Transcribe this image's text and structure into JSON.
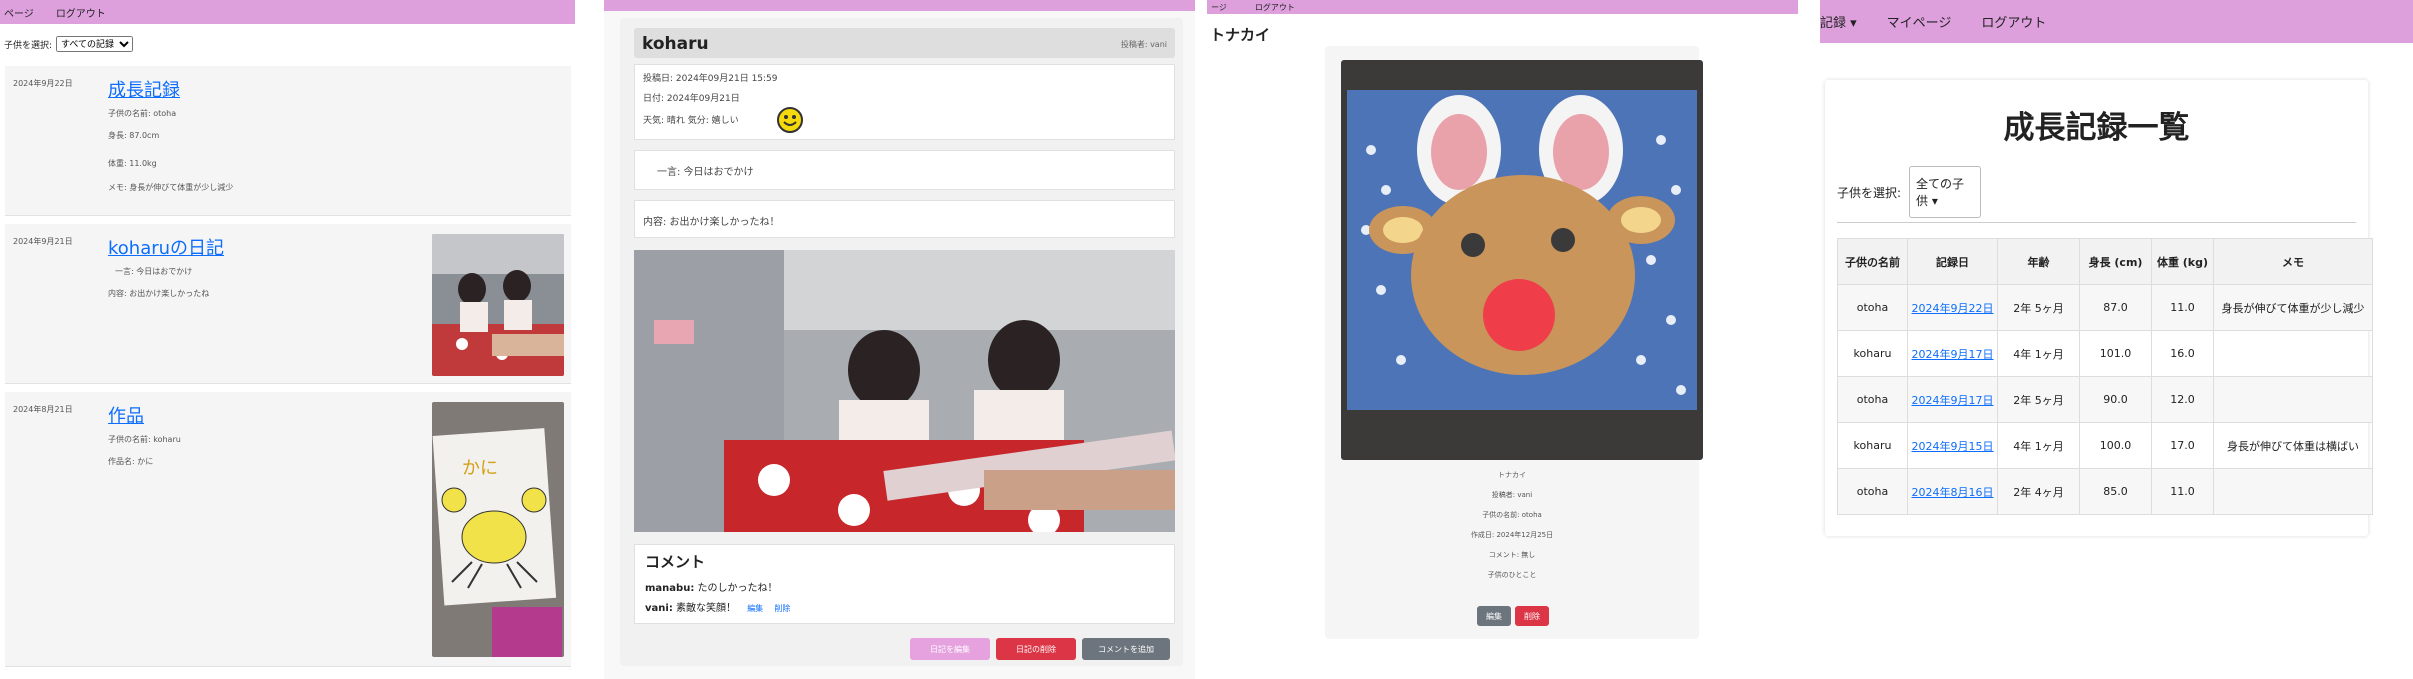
{
  "panel1": {
    "nav": [
      "ページ",
      "ログアウト"
    ],
    "filter_label": "子供を選択:",
    "filter_value": "すべての記録",
    "entries": [
      {
        "date": "2024年9月22日",
        "title": "成長記録",
        "lines": [
          "子供の名前: otoha",
          "身長: 87.0cm",
          "体重: 11.0kg",
          "メモ: 身長が伸びて体重が少し減少"
        ]
      },
      {
        "date": "2024年9月21日",
        "title": "koharuの日記",
        "lines": [
          "一言: 今日はおでかけ",
          "内容: お出かけ楽しかったね"
        ]
      },
      {
        "date": "2024年8月21日",
        "title": "作品",
        "lines": [
          "子供の名前: koharu",
          "作品名: かに"
        ]
      }
    ]
  },
  "panel2": {
    "child_name": "koharu",
    "poster": "投稿者: vani",
    "posted": "投稿日: 2024年09月21日 15:59",
    "date": "日付: 2024年09月21日",
    "weather": "天気: 晴れ  気分: 嬉しい",
    "oneline": "一言: 今日はおでかけ",
    "content": "内容: お出かけ楽しかったね！",
    "comment_title": "コメント",
    "comments": [
      {
        "user": "manabu:",
        "text": "たのしかったね！"
      },
      {
        "user": "vani:",
        "text": "素敵な笑顔！",
        "edit": "編集",
        "del": "削除"
      }
    ],
    "buttons": {
      "edit": "日記を編集",
      "delete": "日記の削除",
      "comment": "コメントを追加"
    },
    "colors": {
      "edit": "#e6a1df",
      "delete": "#dc3545",
      "comment": "#6c757d"
    }
  },
  "panel3": {
    "nav": [
      "ージ",
      "ログアウト"
    ],
    "heading": "トナカイ",
    "meta": [
      "トナカイ",
      "投稿者: vani",
      "子供の名前: otoha",
      "作成日: 2024年12月25日",
      "コメント: 無し",
      "子供のひとこと"
    ],
    "buttons": {
      "edit": "編集",
      "delete": "削除"
    }
  },
  "panel4": {
    "nav": [
      "記録 ▾",
      "マイページ",
      "ログアウト"
    ],
    "title": "成長記録一覧",
    "select_label": "子供を選択:",
    "select_value": "全ての子供 ▾",
    "headers": [
      "子供の名前",
      "記録日",
      "年齢",
      "身長 (cm)",
      "体重 (kg)",
      "メモ"
    ],
    "rows": [
      [
        "otoha",
        "2024年9月22日",
        "2年 5ヶ月",
        "87.0",
        "11.0",
        "身長が伸びて体重が少し減少"
      ],
      [
        "koharu",
        "2024年9月17日",
        "4年 1ヶ月",
        "101.0",
        "16.0",
        ""
      ],
      [
        "otoha",
        "2024年9月17日",
        "2年 5ヶ月",
        "90.0",
        "12.0",
        ""
      ],
      [
        "koharu",
        "2024年9月15日",
        "4年 1ヶ月",
        "100.0",
        "17.0",
        "身長が伸びて体重は横ばい"
      ],
      [
        "otoha",
        "2024年8月16日",
        "2年 4ヶ月",
        "85.0",
        "11.0",
        ""
      ]
    ]
  }
}
